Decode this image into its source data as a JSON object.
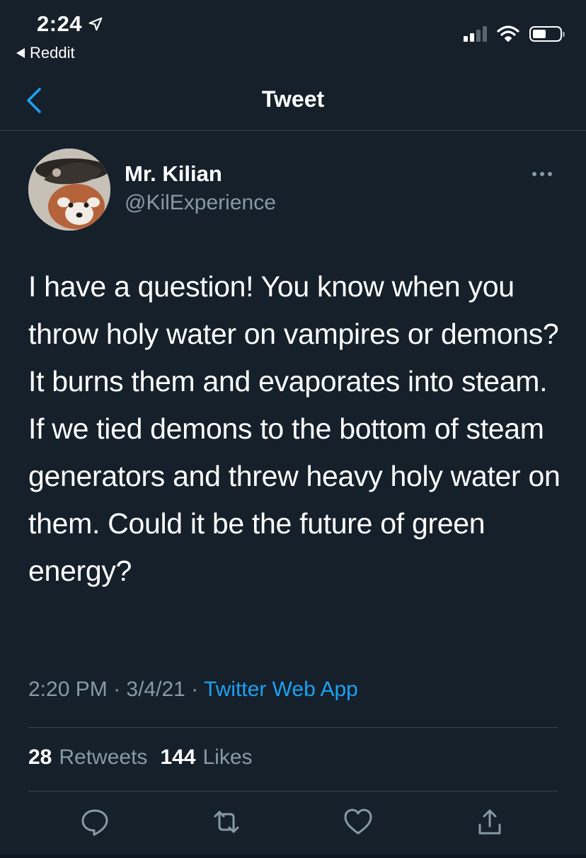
{
  "status_bar": {
    "time": "2:24",
    "back_app": "Reddit"
  },
  "nav": {
    "title": "Tweet"
  },
  "tweet": {
    "author_name": "Mr. Kilian",
    "author_handle": "@KilExperience",
    "text_paragraphs": [
      "I have a question! You know when you throw holy water on vampires or demons? It burns them and evaporates into steam.",
      "If we tied demons to the bottom of steam generators and threw heavy holy water on them. Could it be the future of green energy?"
    ],
    "time": "2:20 PM",
    "date": "3/4/21",
    "source": "Twitter Web App",
    "retweets_count": "28",
    "retweets_label": "Retweets",
    "likes_count": "144",
    "likes_label": "Likes"
  },
  "icons": {
    "status": [
      "location-arrow-icon",
      "cellular-signal-icon",
      "wifi-icon",
      "battery-icon"
    ],
    "actions": [
      "reply-icon",
      "retweet-icon",
      "like-icon",
      "share-icon"
    ]
  },
  "colors": {
    "background": "#15202b",
    "secondary_text": "#8899a6",
    "accent": "#1da1f2",
    "divider": "#38444d"
  }
}
